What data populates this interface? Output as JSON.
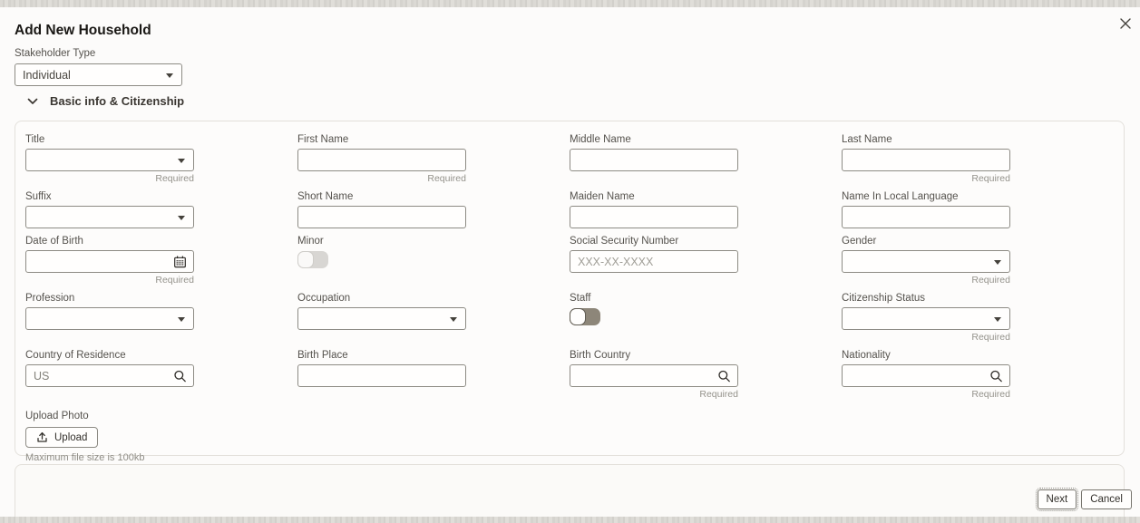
{
  "chrome": {
    "close_icon": "close"
  },
  "header": {
    "title": "Add New Household"
  },
  "stakeholder": {
    "label": "Stakeholder Type",
    "value": "Individual"
  },
  "section": {
    "title": "Basic info & Citizenship"
  },
  "hints": {
    "required": "Required"
  },
  "fields": {
    "title": {
      "label": "Title"
    },
    "first_name": {
      "label": "First Name"
    },
    "middle_name": {
      "label": "Middle Name"
    },
    "last_name": {
      "label": "Last Name"
    },
    "suffix": {
      "label": "Suffix"
    },
    "short_name": {
      "label": "Short Name"
    },
    "maiden_name": {
      "label": "Maiden Name"
    },
    "name_in_local_language": {
      "label": "Name In Local Language"
    },
    "date_of_birth": {
      "label": "Date of Birth"
    },
    "minor": {
      "label": "Minor",
      "state": "off-disabled"
    },
    "ssn": {
      "label": "Social Security Number",
      "placeholder": "XXX-XX-XXXX"
    },
    "gender": {
      "label": "Gender"
    },
    "profession": {
      "label": "Profession"
    },
    "occupation": {
      "label": "Occupation"
    },
    "staff": {
      "label": "Staff",
      "state": "off"
    },
    "citizenship_status": {
      "label": "Citizenship Status"
    },
    "country_of_residence": {
      "label": "Country of Residence",
      "value": "US"
    },
    "birth_place": {
      "label": "Birth Place"
    },
    "birth_country": {
      "label": "Birth Country"
    },
    "nationality": {
      "label": "Nationality"
    }
  },
  "upload": {
    "label": "Upload Photo",
    "button": "Upload",
    "hint": "Maximum file size is 100kb"
  },
  "footer": {
    "next": "Next",
    "cancel": "Cancel"
  },
  "colors": {
    "toggle_track": "#8d8679",
    "toggle_track_disabled": "#d8d6d3",
    "input_border": "#8d8b84",
    "panel_border": "#e3e0db"
  }
}
